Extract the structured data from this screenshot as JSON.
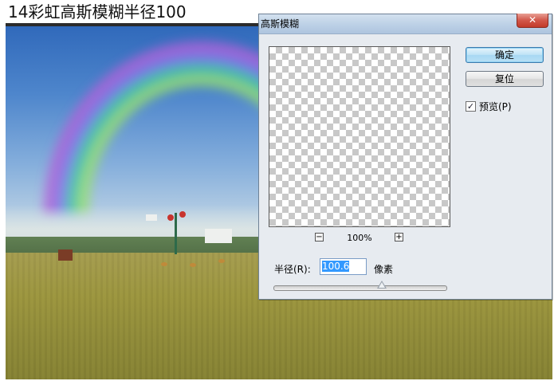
{
  "caption": "14彩虹高斯模糊半径100",
  "dialog": {
    "title": "高斯模糊",
    "close_glyph": "✕",
    "ok_label": "确定",
    "reset_label": "复位",
    "preview_checked": true,
    "preview_label": "预览(P)",
    "zoom_out_glyph": "−",
    "zoom_in_glyph": "+",
    "zoom_level": "100%",
    "radius_label": "半径(R):",
    "radius_value": "100.6",
    "radius_unit": "像素",
    "radius_slider_fraction": 0.63
  },
  "colors": {
    "titlebar": "#bcd0e6",
    "close_button": "#c23a2a",
    "primary_button": "#a7d8f3",
    "selection": "#3399ff"
  }
}
